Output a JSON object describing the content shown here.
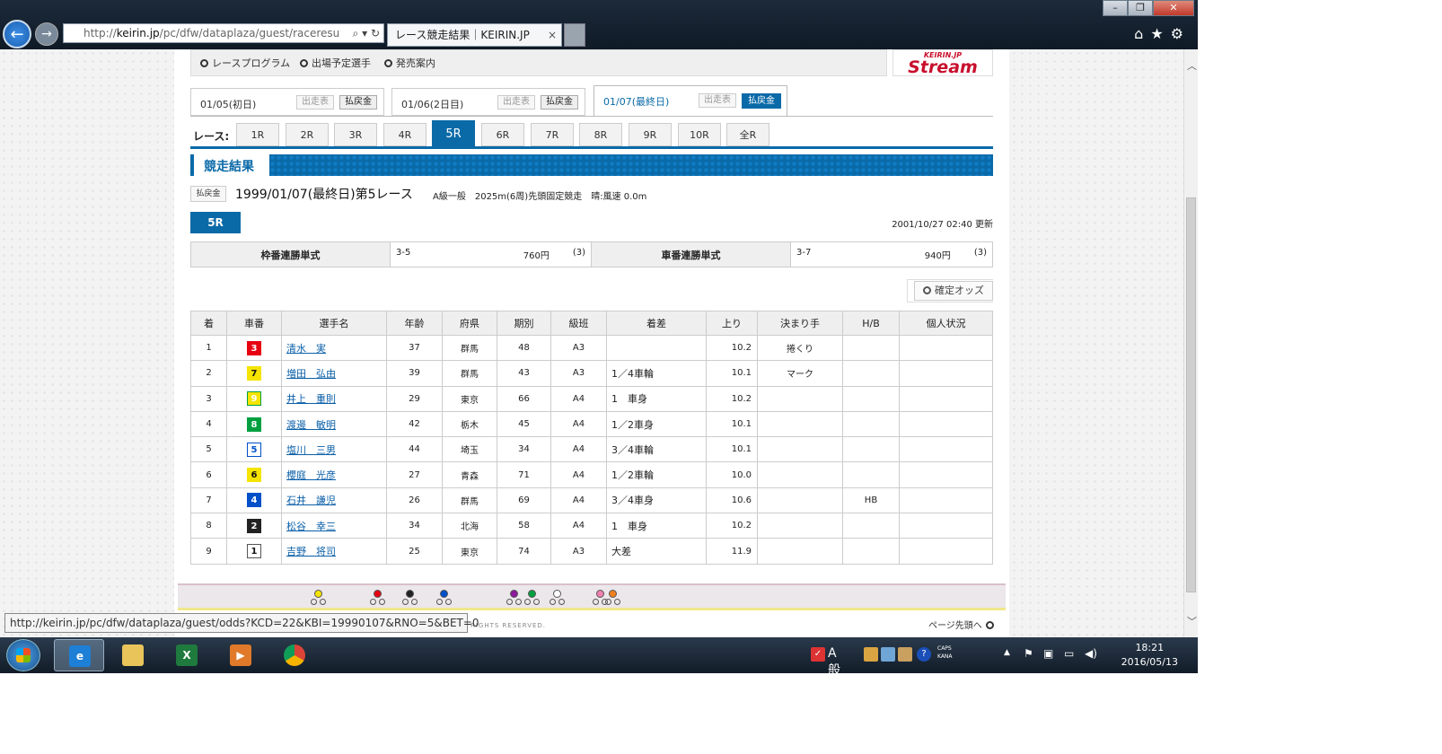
{
  "browser": {
    "url_scheme": "http://",
    "url_host": "keirin.jp",
    "url_path": "/pc/dfw/dataplaza/guest/raceresu",
    "tab_title": "レース競走結果｜KEIRIN.JP",
    "tab_close": "×",
    "window_controls": [
      "–",
      "❐",
      "✕"
    ]
  },
  "top_nav": {
    "links": [
      "レースプログラム",
      "出場予定選手",
      "発売案内"
    ],
    "stream_top": "KEIRIN.JP",
    "stream_main": "Stream"
  },
  "day_tabs": [
    {
      "label": "01/05(初日)",
      "entry_label": "出走表",
      "payout_label": "払戻金"
    },
    {
      "label": "01/06(2日目)",
      "entry_label": "出走表",
      "payout_label": "払戻金"
    },
    {
      "label": "01/07(最終日)",
      "entry_label": "出走表",
      "payout_label": "払戻金"
    }
  ],
  "race_nav": {
    "label": "レース:",
    "races": [
      "1R",
      "2R",
      "3R",
      "4R",
      "5R",
      "6R",
      "7R",
      "8R",
      "9R",
      "10R",
      "全R"
    ],
    "active": "5R"
  },
  "section": {
    "title": "競走結果"
  },
  "race": {
    "payout_badge": "払戻金",
    "title": "1999/01/07(最終日)第5レース",
    "info": "A級一般　2025m(6周)先頭固定競走　晴:風速 0.0m",
    "badge": "5R",
    "updated": "2001/10/27 02:40 更新"
  },
  "odds": {
    "bracket": {
      "label": "枠番連勝単式",
      "combo": "3-5",
      "payout": "760円",
      "rank": "(3)"
    },
    "car": {
      "label": "車番連勝単式",
      "combo": "3-7",
      "payout": "940円",
      "rank": "(3)"
    },
    "confirm_label": "確定オッズ"
  },
  "results": {
    "headers": [
      "着",
      "車番",
      "選手名",
      "年齢",
      "府県",
      "期別",
      "級班",
      "着差",
      "上り",
      "決まり手",
      "H/B",
      "個人状況"
    ],
    "rows": [
      {
        "place": "1",
        "car": "3",
        "name": "清水　実",
        "age": "37",
        "pref": "群馬",
        "term": "48",
        "class": "A3",
        "margin": "",
        "last": "10.2",
        "kimarite": "捲くり",
        "hb": "",
        "status": ""
      },
      {
        "place": "2",
        "car": "7",
        "name": "増田　弘由",
        "age": "39",
        "pref": "群馬",
        "term": "43",
        "class": "A3",
        "margin": "1／4車輪",
        "last": "10.1",
        "kimarite": "マーク",
        "hb": "",
        "status": ""
      },
      {
        "place": "3",
        "car": "9",
        "name": "井上　重則",
        "age": "29",
        "pref": "東京",
        "term": "66",
        "class": "A4",
        "margin": "1　車身",
        "last": "10.2",
        "kimarite": "",
        "hb": "",
        "status": ""
      },
      {
        "place": "4",
        "car": "8",
        "name": "渡邊　敏明",
        "age": "42",
        "pref": "栃木",
        "term": "45",
        "class": "A4",
        "margin": "1／2車身",
        "last": "10.1",
        "kimarite": "",
        "hb": "",
        "status": ""
      },
      {
        "place": "5",
        "car": "5",
        "name": "塩川　三男",
        "age": "44",
        "pref": "埼玉",
        "term": "34",
        "class": "A4",
        "margin": "3／4車輪",
        "last": "10.1",
        "kimarite": "",
        "hb": "",
        "status": ""
      },
      {
        "place": "6",
        "car": "6",
        "name": "櫻庭　光彦",
        "age": "27",
        "pref": "青森",
        "term": "71",
        "class": "A4",
        "margin": "1／2車輪",
        "last": "10.0",
        "kimarite": "",
        "hb": "",
        "status": ""
      },
      {
        "place": "7",
        "car": "4",
        "name": "石井　謙児",
        "age": "26",
        "pref": "群馬",
        "term": "69",
        "class": "A4",
        "margin": "3／4車身",
        "last": "10.6",
        "kimarite": "",
        "hb": "HB",
        "status": ""
      },
      {
        "place": "8",
        "car": "2",
        "name": "松谷　幸三",
        "age": "34",
        "pref": "北海",
        "term": "58",
        "class": "A4",
        "margin": "1　車身",
        "last": "10.2",
        "kimarite": "",
        "hb": "",
        "status": ""
      },
      {
        "place": "9",
        "car": "1",
        "name": "吉野　将司",
        "age": "25",
        "pref": "東京",
        "term": "74",
        "class": "A3",
        "margin": "大差",
        "last": "11.9",
        "kimarite": "",
        "hb": "",
        "status": ""
      }
    ]
  },
  "car_colors": {
    "1": {
      "bg": "#ffffff",
      "fg": "#111111",
      "border": "#555555"
    },
    "2": {
      "bg": "#222222",
      "fg": "#ffffff",
      "border": "#222222"
    },
    "3": {
      "bg": "#e60012",
      "fg": "#ffffff",
      "border": "#e60012"
    },
    "4": {
      "bg": "#0050c8",
      "fg": "#ffffff",
      "border": "#0050c8"
    },
    "5": {
      "bg": "#ffffff",
      "fg": "#0050c8",
      "border": "#0050c8"
    },
    "6": {
      "bg": "#f5e400",
      "fg": "#111111",
      "border": "#f5e400"
    },
    "7": {
      "bg": "#f5e400",
      "fg": "#111111",
      "border": "#f5e400"
    },
    "8": {
      "bg": "#00a040",
      "fg": "#ffffff",
      "border": "#00a040"
    },
    "9": {
      "bg": "#f5e400",
      "fg": "#ffffff",
      "border": "#00a040"
    }
  },
  "footer": {
    "copyright": "RIGHTS RESERVED.",
    "page_top": "ページ先頭へ"
  },
  "status_bar": {
    "link": "http://keirin.jp/pc/dfw/dataplaza/guest/odds?KCD=22&KBI=19990107&RNO=5&BET=0"
  },
  "taskbar": {
    "apps": [
      "internet-explorer",
      "file-explorer",
      "excel",
      "media-player",
      "chrome"
    ],
    "ime_text": "A 般",
    "caps_lines": [
      "CAPS",
      "KANA"
    ],
    "time": "18:21",
    "date": "2016/05/13"
  },
  "accent_color": "#0a6aa8"
}
